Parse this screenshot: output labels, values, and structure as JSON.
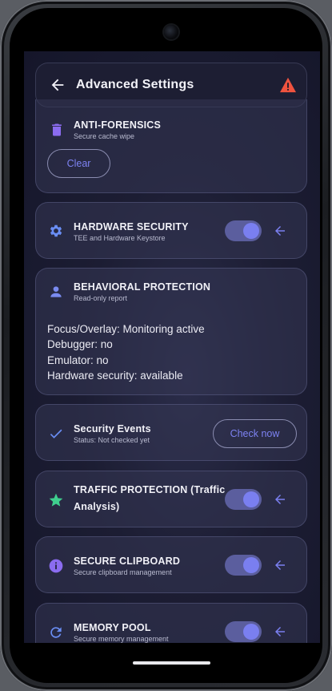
{
  "header": {
    "title": "Advanced Settings"
  },
  "anti_forensics": {
    "title": "ANTI-FORENSICS",
    "subtitle": "Secure cache wipe",
    "button": "Clear"
  },
  "hardware_security": {
    "title": "HARDWARE SECURITY",
    "subtitle": "TEE and Hardware Keystore",
    "enabled": true
  },
  "behavioral": {
    "title": "BEHAVIORAL PROTECTION",
    "subtitle": "Read-only report",
    "lines": [
      "Focus/Overlay: Monitoring active",
      "Debugger: no",
      "Emulator: no",
      "Hardware security: available"
    ]
  },
  "security_events": {
    "title": "Security Events",
    "subtitle": "Status: Not checked yet",
    "button": "Check now"
  },
  "traffic": {
    "title_line1": "TRAFFIC PROTECTION (Traffic",
    "title_line2": "Analysis)",
    "enabled": true
  },
  "clipboard": {
    "title": "SECURE CLIPBOARD",
    "subtitle": "Secure clipboard management",
    "enabled": true
  },
  "memory": {
    "title": "MEMORY POOL",
    "subtitle": "Secure memory management",
    "enabled": true
  },
  "colors": {
    "accent": "#7a7ff0",
    "warning": "#f0533f",
    "trash": "#8b6cf0",
    "green": "#3fcf8e"
  },
  "icons": [
    "back-arrow-icon",
    "warning-icon",
    "trash-icon",
    "gear-icon",
    "person-icon",
    "check-icon",
    "star-icon",
    "info-icon",
    "refresh-icon",
    "arrow-left-icon"
  ]
}
